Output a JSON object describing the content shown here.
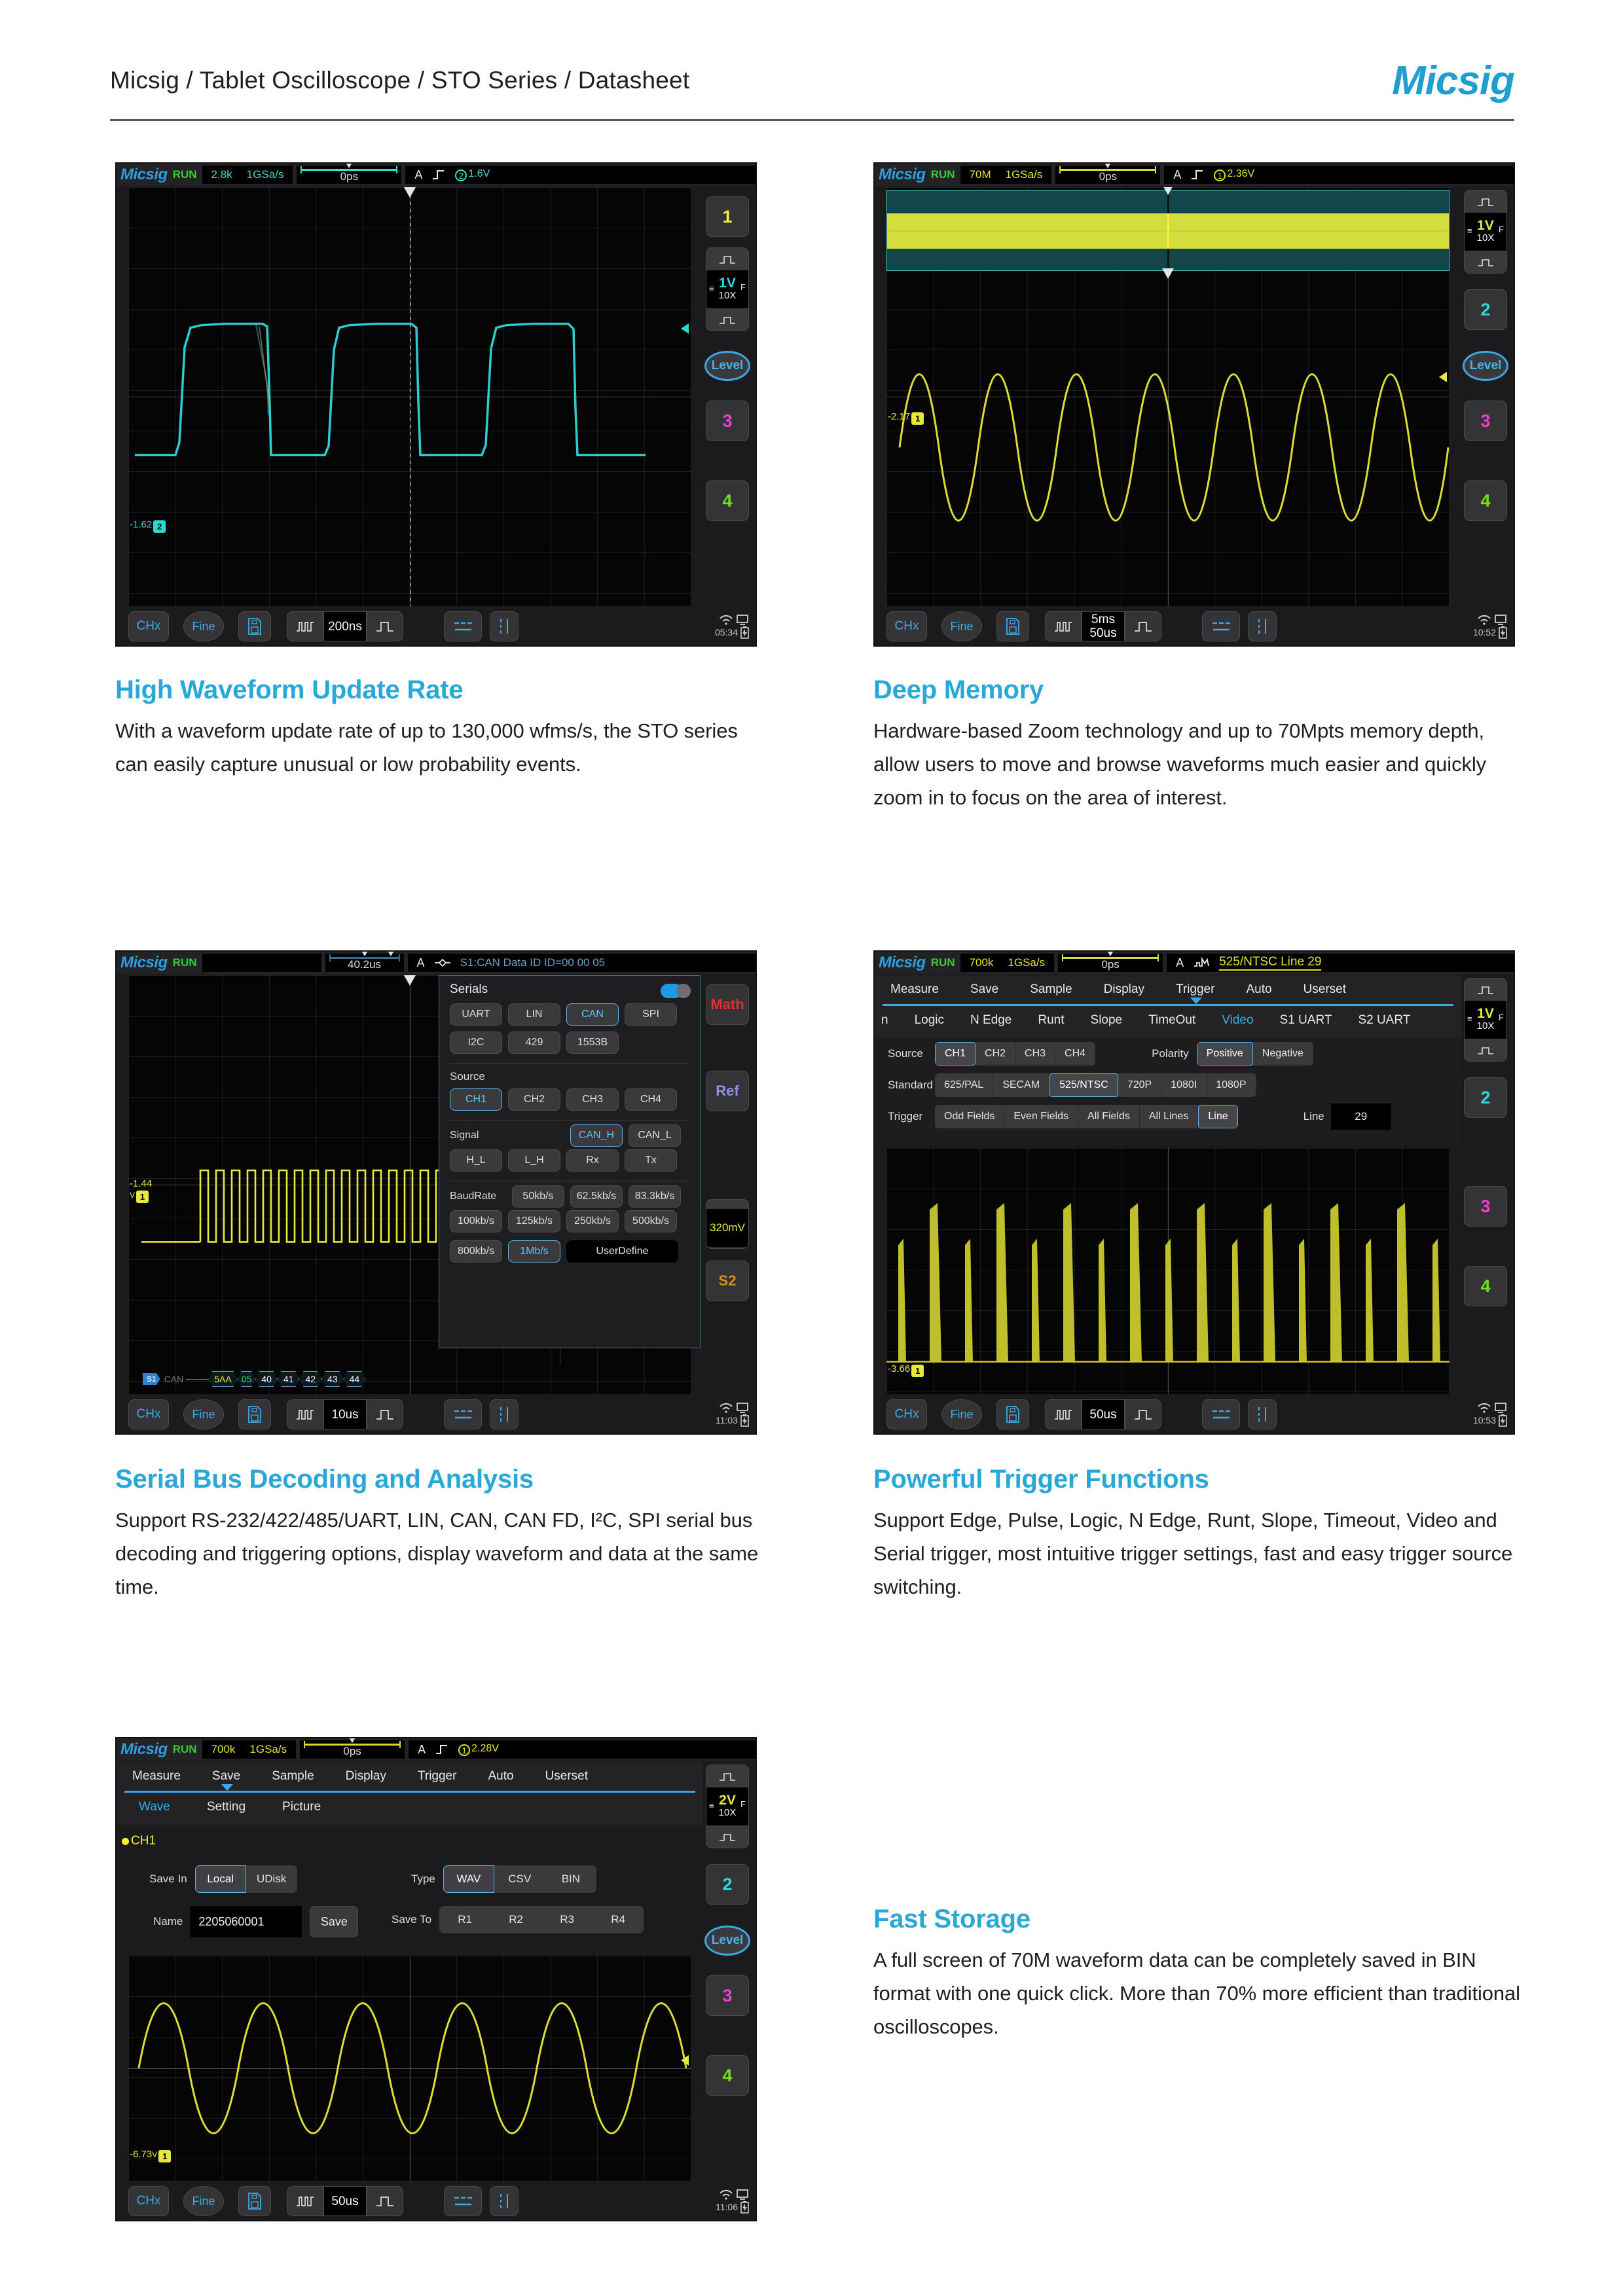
{
  "header": {
    "breadcrumb": "Micsig / Tablet Oscilloscope / STO Series / Datasheet",
    "brand": "Micsig",
    "brand_color": "#1f9fd0"
  },
  "accent_color": "#29a8d8",
  "features": [
    {
      "title": "High Waveform Update Rate",
      "body": "With a waveform update rate of up to 130,000 wfms/s, the STO series can easily capture unusual or low probability events."
    },
    {
      "title": "Deep Memory",
      "body": "Hardware-based Zoom technology and up to 70Mpts memory depth, allow users to move and browse waveforms much easier and quickly zoom in to focus on the area of interest."
    },
    {
      "title": "Serial Bus Decoding and Analysis",
      "body": "Support RS-232/422/485/UART, LIN, CAN, CAN FD, I²C, SPI serial bus decoding and triggering options, display waveform and data at the same time."
    },
    {
      "title": "Powerful Trigger Functions",
      "body": "Support Edge, Pulse, Logic, N Edge, Runt, Slope, Timeout, Video and Serial trigger, most intuitive trigger settings, fast and easy trigger source switching."
    },
    {
      "title": "Fast Storage",
      "body": "A full screen of 70M waveform data can be completely saved in BIN format with one quick click. More than 70% more efficient than traditional oscilloscopes."
    }
  ],
  "scope1": {
    "logo": "Micsig",
    "run_state": "RUN",
    "mem_depth": "2.8k",
    "sample_rate": "1GSa/s",
    "time_offset": "0ps",
    "trigger_label": "A",
    "trigger_source": "2",
    "trigger_level": "1.6V",
    "channel_marker": "-1.62",
    "channel_marker_num": "2",
    "vdiv": "1V",
    "probe": "10X",
    "coupling": "F",
    "channel_buttons": [
      "1",
      "3",
      "4"
    ],
    "level_label": "Level",
    "toolbar": {
      "chx": "CHx",
      "fine": "Fine",
      "timebase": "200ns"
    },
    "clock": "05:34"
  },
  "scope2": {
    "logo": "Micsig",
    "run_state": "RUN",
    "mem_depth": "70M",
    "sample_rate": "1GSa/s",
    "time_offset": "0ps",
    "trigger_label": "A",
    "trigger_source": "1",
    "trigger_level": "2.36V",
    "channel_marker": "-2.17",
    "channel_marker_num": "1",
    "vdiv": "1V",
    "probe": "10X",
    "coupling": "F",
    "channel_buttons": [
      "2",
      "3",
      "4"
    ],
    "level_label": "Level",
    "toolbar": {
      "chx": "CHx",
      "fine": "Fine",
      "timebase_top": "5ms",
      "timebase_bottom": "50us"
    },
    "clock": "10:52"
  },
  "scope3": {
    "logo": "Micsig",
    "run_state": "RUN",
    "time_offset": "40.2us",
    "trigger_label": "A",
    "trigger_desc": "S1:CAN Data ID ID=00 00 05",
    "channel_marker": "-1.44",
    "channel_marker_unit": "V",
    "channel_marker_num": "1",
    "serials": {
      "title": "Serials",
      "enabled": true,
      "protocols": [
        "UART",
        "LIN",
        "CAN",
        "SPI",
        "I2C",
        "429",
        "1553B"
      ],
      "protocol_selected": "CAN",
      "source_label": "Source",
      "sources": [
        "CH1",
        "CH2",
        "CH3",
        "CH4"
      ],
      "source_selected": "CH1",
      "signal_label": "Signal",
      "signals_row1": [
        "CAN_H",
        "CAN_L"
      ],
      "signals_row2": [
        "H_L",
        "L_H",
        "Rx",
        "Tx"
      ],
      "signal_selected": "CAN_H",
      "baud_label": "BaudRate",
      "baud_rates": [
        "50kb/s",
        "62.5kb/s",
        "83.3kb/s",
        "100kb/s",
        "125kb/s",
        "250kb/s",
        "500kb/s",
        "800kb/s",
        "1Mb/s"
      ],
      "baud_selected": "1Mb/s",
      "user_define": "UserDefine"
    },
    "side_buttons": [
      "Math",
      "Ref",
      "S2"
    ],
    "side_value": "320mV",
    "bus": {
      "tag": "S1",
      "name": "CAN",
      "cells": [
        "5AA",
        "05",
        "40",
        "41",
        "42",
        "43",
        "44"
      ]
    },
    "toolbar": {
      "chx": "CHx",
      "fine": "Fine",
      "timebase": "10us"
    },
    "clock": "11:03"
  },
  "scope4": {
    "logo": "Micsig",
    "run_state": "RUN",
    "mem_depth": "700k",
    "sample_rate": "1GSa/s",
    "time_offset": "0ps",
    "trigger_label": "A",
    "trigger_desc": "525/NTSC Line 29",
    "channel_marker": "-3.66",
    "channel_marker_num": "1",
    "menu_top": [
      "Measure",
      "Save",
      "Sample",
      "Display",
      "Trigger",
      "Auto",
      "Userset"
    ],
    "menu_top_active": "Trigger",
    "menu_sub": [
      "n",
      "Logic",
      "N Edge",
      "Runt",
      "Slope",
      "TimeOut",
      "Video",
      "S1 UART",
      "S2 UART"
    ],
    "menu_sub_active": "Video",
    "source_label": "Source",
    "sources": [
      "CH1",
      "CH2",
      "CH3",
      "CH4"
    ],
    "source_selected": "CH1",
    "polarity_label": "Polarity",
    "polarities": [
      "Positive",
      "Negative"
    ],
    "polarity_selected": "Positive",
    "standard_label": "Standard",
    "standards": [
      "625/PAL",
      "SECAM",
      "525/NTSC",
      "720P",
      "1080I",
      "1080P"
    ],
    "standard_selected": "525/NTSC",
    "trigger_mode_label": "Trigger",
    "trigger_modes": [
      "Odd Fields",
      "Even Fields",
      "All Fields",
      "All Lines",
      "Line"
    ],
    "trigger_mode_selected": "Line",
    "line_label": "Line",
    "line_value": "29",
    "vdiv": "1V",
    "probe": "10X",
    "coupling": "F",
    "channel_buttons": [
      "2",
      "3",
      "4"
    ],
    "toolbar": {
      "chx": "CHx",
      "fine": "Fine",
      "timebase": "50us"
    },
    "clock": "10:53"
  },
  "scope5": {
    "logo": "Micsig",
    "run_state": "RUN",
    "mem_depth": "700k",
    "sample_rate": "1GSa/s",
    "time_offset": "0ps",
    "trigger_label": "A",
    "trigger_source": "1",
    "trigger_level": "2.28V",
    "channel_marker": "-6.73",
    "channel_marker_unit": "V",
    "channel_marker_num": "1",
    "menu_top": [
      "Measure",
      "Save",
      "Sample",
      "Display",
      "Trigger",
      "Auto",
      "Userset"
    ],
    "menu_top_active": "Save",
    "menu_sub": [
      "Wave",
      "Setting",
      "Picture"
    ],
    "menu_sub_active": "Wave",
    "channel_label": "CH1",
    "save_in_label": "Save In",
    "save_in_options": [
      "Local",
      "UDisk"
    ],
    "save_in_selected": "Local",
    "type_label": "Type",
    "type_options": [
      "WAV",
      "CSV",
      "BIN"
    ],
    "type_selected": "WAV",
    "name_label": "Name",
    "name_value": "2205060001",
    "save_button": "Save",
    "save_to_label": "Save To",
    "save_to_options": [
      "R1",
      "R2",
      "R3",
      "R4"
    ],
    "vdiv": "2V",
    "probe": "10X",
    "coupling": "F",
    "channel_buttons": [
      "2",
      "3",
      "4"
    ],
    "level_label": "Level",
    "toolbar": {
      "chx": "CHx",
      "fine": "Fine",
      "timebase": "50us"
    },
    "clock": "11:06"
  }
}
